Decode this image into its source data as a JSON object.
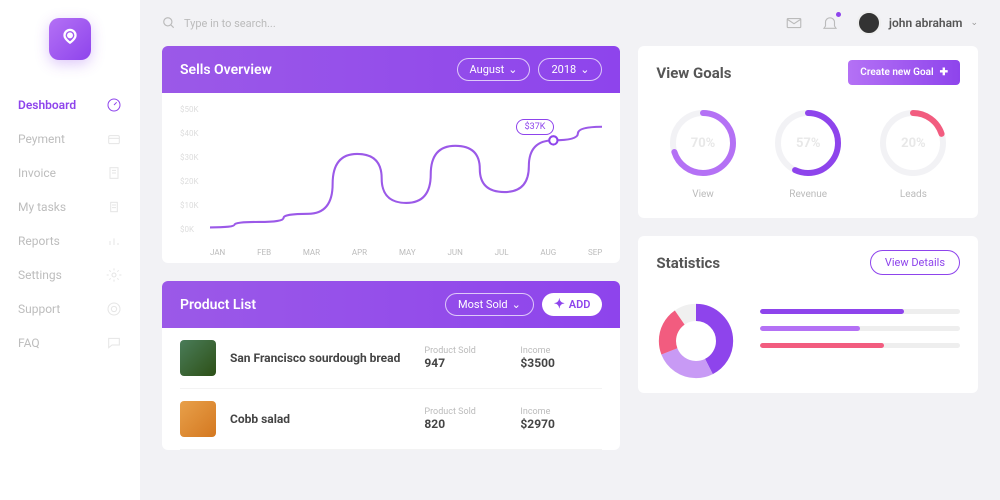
{
  "search": {
    "placeholder": "Type in to search..."
  },
  "user": {
    "name": "john abraham"
  },
  "sidebar": [
    {
      "label": "Deshboard",
      "icon": "gauge",
      "active": true
    },
    {
      "label": "Peyment",
      "icon": "wallet"
    },
    {
      "label": "Invoice",
      "icon": "receipt"
    },
    {
      "label": "My tasks",
      "icon": "clipboard"
    },
    {
      "label": "Reports",
      "icon": "barchart"
    },
    {
      "label": "Settings",
      "icon": "gear"
    },
    {
      "label": "Support",
      "icon": "lifebuoy"
    },
    {
      "label": "FAQ",
      "icon": "chat"
    }
  ],
  "sells": {
    "title": "Sells Overview",
    "month": "August",
    "year": "2018",
    "tooltip": "$37K"
  },
  "goals": {
    "title": "View Goals",
    "button": "Create new Goal",
    "rings": [
      {
        "label": "View",
        "value": "70%",
        "pct": 70,
        "color": "#b471f5"
      },
      {
        "label": "Revenue",
        "value": "57%",
        "pct": 57,
        "color": "#8e44ec"
      },
      {
        "label": "Leads",
        "value": "20%",
        "pct": 20,
        "color": "#f25c7f"
      }
    ]
  },
  "products": {
    "title": "Product List",
    "sort": "Most Sold",
    "add": "ADD",
    "sold_label": "Product Sold",
    "income_label": "Income",
    "items": [
      {
        "name": "San Francisco sourdough bread",
        "sold": "947",
        "income": "$3500"
      },
      {
        "name": "Cobb salad",
        "sold": "820",
        "income": "$2970"
      }
    ]
  },
  "stats": {
    "title": "Statistics",
    "button": "View Details",
    "bars": [
      {
        "pct": 72,
        "color": "#8e44ec"
      },
      {
        "pct": 50,
        "color": "#b471f5"
      },
      {
        "pct": 62,
        "color": "#f25c7f"
      }
    ]
  },
  "chart_data": {
    "type": "line",
    "title": "Sells Overview",
    "xlabel": "",
    "ylabel": "",
    "ylim": [
      0,
      50
    ],
    "yticks": [
      "$50K",
      "$40K",
      "$30K",
      "$20K",
      "$10K",
      "$0K"
    ],
    "categories": [
      "JAN",
      "FEB",
      "MAR",
      "APR",
      "MAY",
      "JUN",
      "JUL",
      "AUG",
      "SEP"
    ],
    "values": [
      5,
      7,
      10,
      32,
      14,
      35,
      18,
      37,
      42
    ],
    "highlight": {
      "category": "AUG",
      "value": 37,
      "label": "$37K"
    }
  }
}
